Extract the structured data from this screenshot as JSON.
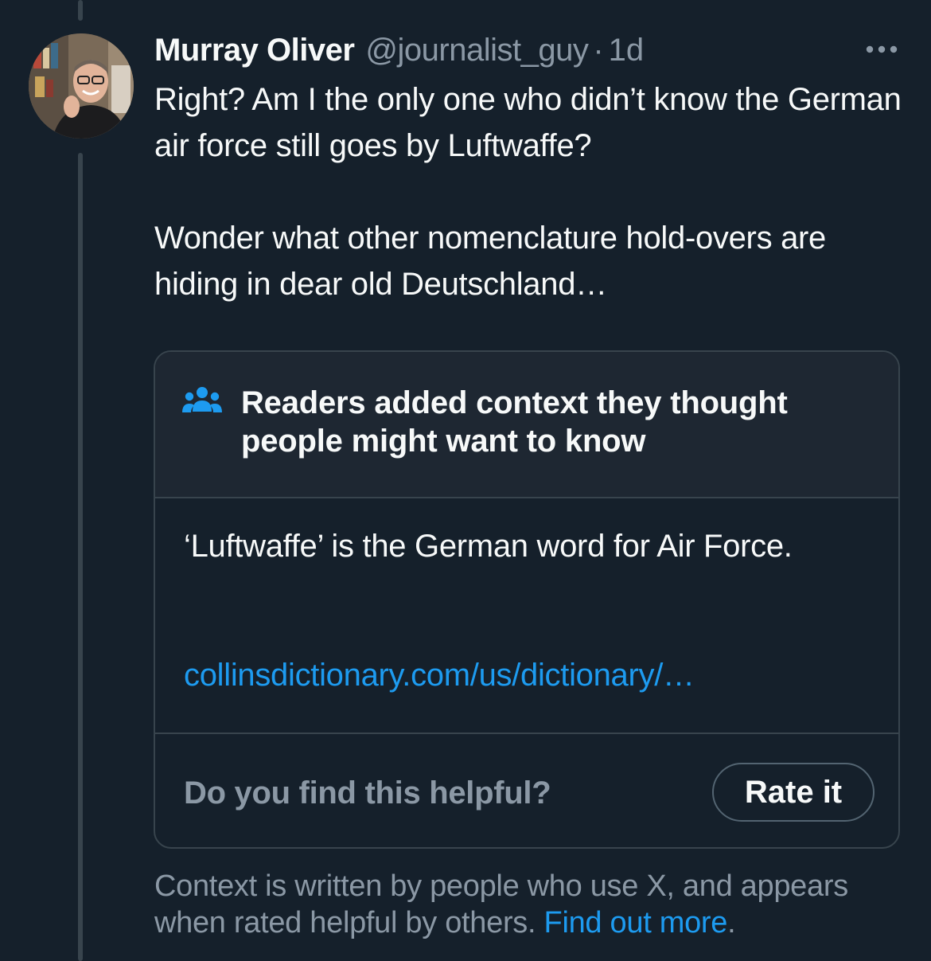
{
  "post": {
    "author": {
      "name": "Murray Oliver",
      "handle": "@journalist_guy",
      "separator": "·",
      "age": "1d"
    },
    "paragraphs": [
      "Right? Am I the only one who didn’t know the German air force still goes by Luftwaffe?",
      "Wonder what other nomenclature hold-overs are hiding in dear old Deutschland…"
    ],
    "more_icon": "more-horizontal-icon"
  },
  "community_note": {
    "icon": "people-icon",
    "title": "Readers added context they thought people might want to know",
    "body": "‘Luftwaffe’ is the German word for Air Force.",
    "link": "collinsdictionary.com/us/dictionary/…",
    "helpful_question": "Do you find this helpful?",
    "rate_label": "Rate it"
  },
  "footer": {
    "text": "Context is written by people who use X, and appears when rated helpful by others.",
    "link": "Find out more",
    "link_suffix": "."
  },
  "colors": {
    "background": "#15202b",
    "text": "#f7f9f9",
    "muted": "#8b98a5",
    "accent": "#1d9bf0",
    "border": "#38444d"
  }
}
